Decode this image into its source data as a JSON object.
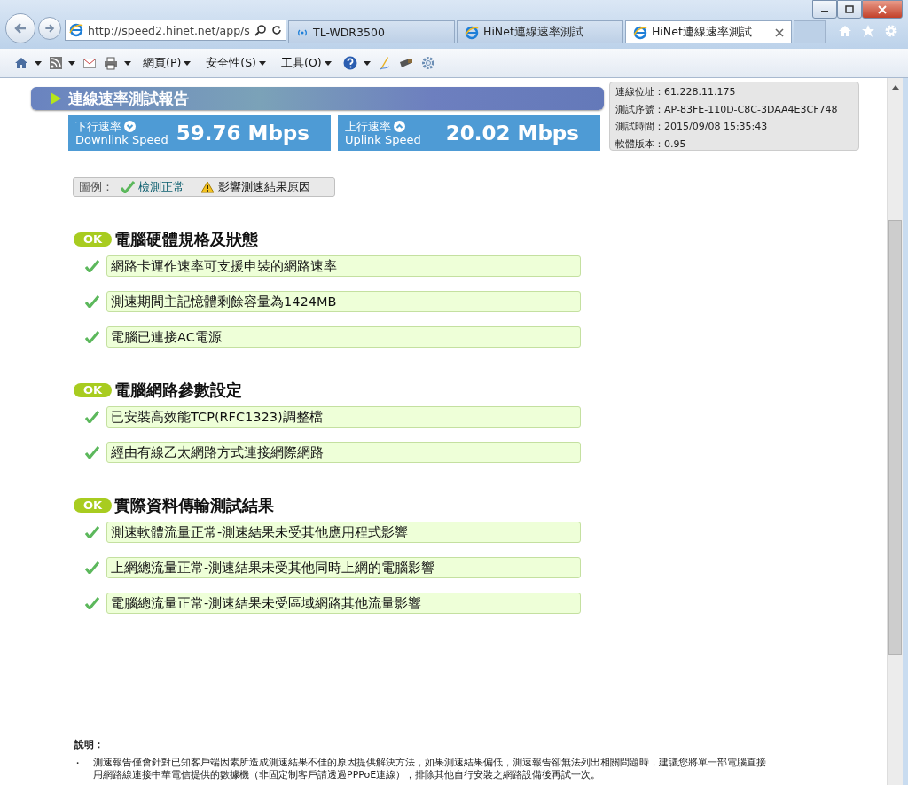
{
  "browser": {
    "address": "http://speed2.hinet.net/app/s",
    "tabs": [
      {
        "label": "TL-WDR3500",
        "kind": "wireless",
        "selected": false
      },
      {
        "label": "HiNet連線速率測試",
        "kind": "ie",
        "selected": false
      },
      {
        "label": "HiNet連線速率測試",
        "kind": "ie",
        "selected": true
      }
    ],
    "menus": [
      "網頁(P)",
      "安全性(S)",
      "工具(O)"
    ]
  },
  "report": {
    "title": "連線速率測試報告",
    "speeds": [
      {
        "label": "下行速率",
        "sublabel": "Downlink Speed",
        "value": "59.76 Mbps",
        "kind": "down"
      },
      {
        "label": "上行速率",
        "sublabel": "Uplink Speed",
        "value": "20.02 Mbps",
        "kind": "up"
      }
    ],
    "info": [
      {
        "label": "連線位址：",
        "value": "61.228.11.175"
      },
      {
        "label": "測試序號：",
        "value": "AP-83FE-110D-C8C-3DAA4E3CF748"
      },
      {
        "label": "測試時間：",
        "value": "2015/09/08 15:35:43"
      },
      {
        "label": "軟體版本：",
        "value": "0.95"
      }
    ],
    "legend": {
      "label": "圖例：",
      "items": [
        {
          "kind": "ok",
          "text": "檢測正常"
        },
        {
          "kind": "warning",
          "text": "影響測速結果原因"
        }
      ]
    },
    "sections": [
      {
        "badge": "OK",
        "title": "電腦硬體規格及狀態",
        "items": [
          {
            "kind": "ok",
            "text": "網路卡運作速率可支援申裝的網路速率"
          },
          {
            "kind": "ok",
            "text": "測速期間主記憶體剩餘容量為1424MB"
          },
          {
            "kind": "ok",
            "text": "電腦已連接AC電源"
          }
        ]
      },
      {
        "badge": "OK",
        "title": "電腦網路參數設定",
        "items": [
          {
            "kind": "ok",
            "text": "已安裝高效能TCP(RFC1323)調整檔"
          },
          {
            "kind": "ok",
            "text": "經由有線乙太網路方式連接網際網路"
          }
        ]
      },
      {
        "badge": "OK",
        "title": "實際資料傳輸測試結果",
        "items": [
          {
            "kind": "ok",
            "text": "測速軟體流量正常-測速結果未受其他應用程式影響"
          },
          {
            "kind": "ok",
            "text": "上網總流量正常-測速結果未受其他同時上網的電腦影響"
          },
          {
            "kind": "ok",
            "text": "電腦總流量正常-測速結果未受區域網路其他流量影響"
          }
        ]
      }
    ],
    "notes_title": "說明：",
    "notes": [
      {
        "bullet": "・",
        "text": "測速報告僅會針對已知客戶端因素所造成測速結果不佳的原因提供解決方法，如果測速結果偏低，測速報告卻無法列出相關問題時，建議您將單一部電腦直接用網路線連接中華電信提供的數據機（非固定制客戶請透過PPPoE連線），排除其他自行安裝之網路設備後再試一次。"
      }
    ]
  }
}
